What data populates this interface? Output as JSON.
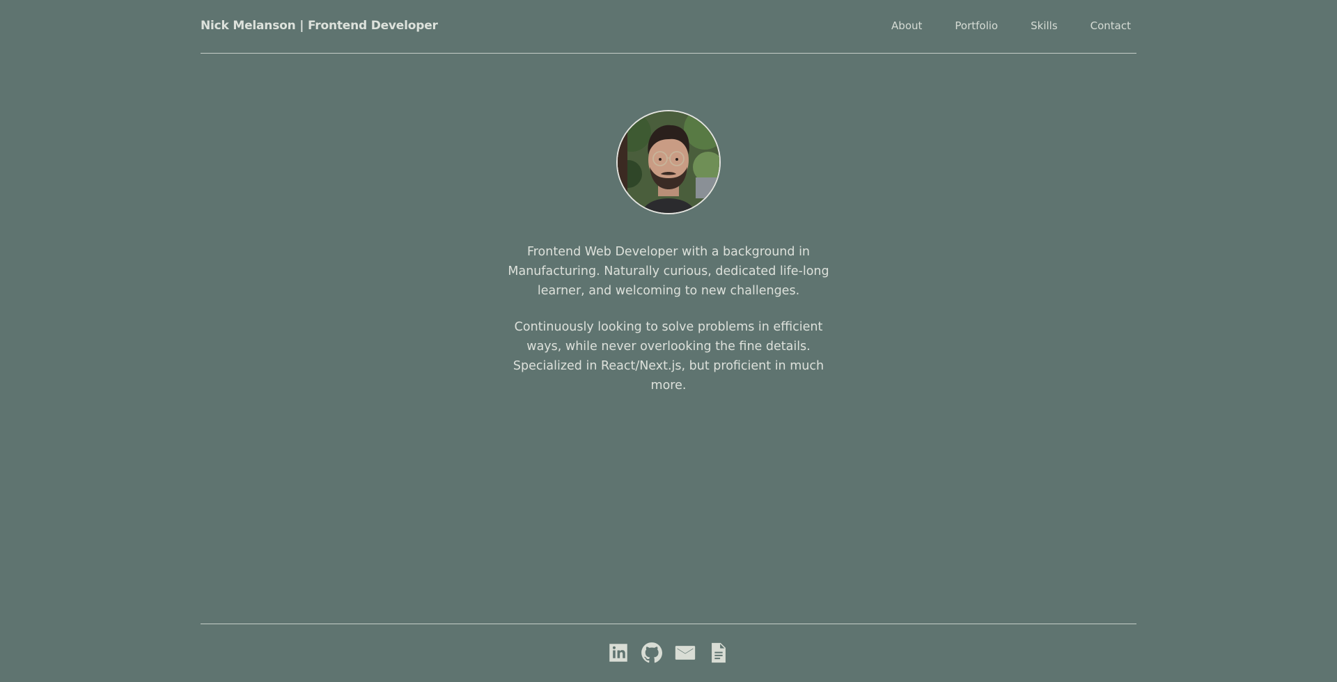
{
  "header": {
    "brand": "Nick Melanson | Frontend Developer",
    "nav": [
      {
        "label": "About"
      },
      {
        "label": "Portfolio"
      },
      {
        "label": "Skills"
      },
      {
        "label": "Contact"
      }
    ]
  },
  "main": {
    "avatar_icon": "profile-photo",
    "bio": [
      "Frontend Web Developer with a background in Manufacturing. Naturally curious, dedicated life-long learner, and welcoming to new challenges.",
      "Continuously looking to solve problems in efficient ways, while never overlooking the fine details. Specialized in React/Next.js, but proficient in much more."
    ]
  },
  "footer": {
    "social_icons": [
      "linkedin-icon",
      "github-icon",
      "mail-icon",
      "resume-document-icon"
    ]
  },
  "colors": {
    "background": "#5f7470",
    "text": "#dde1db",
    "divider": "#c6cec8"
  }
}
